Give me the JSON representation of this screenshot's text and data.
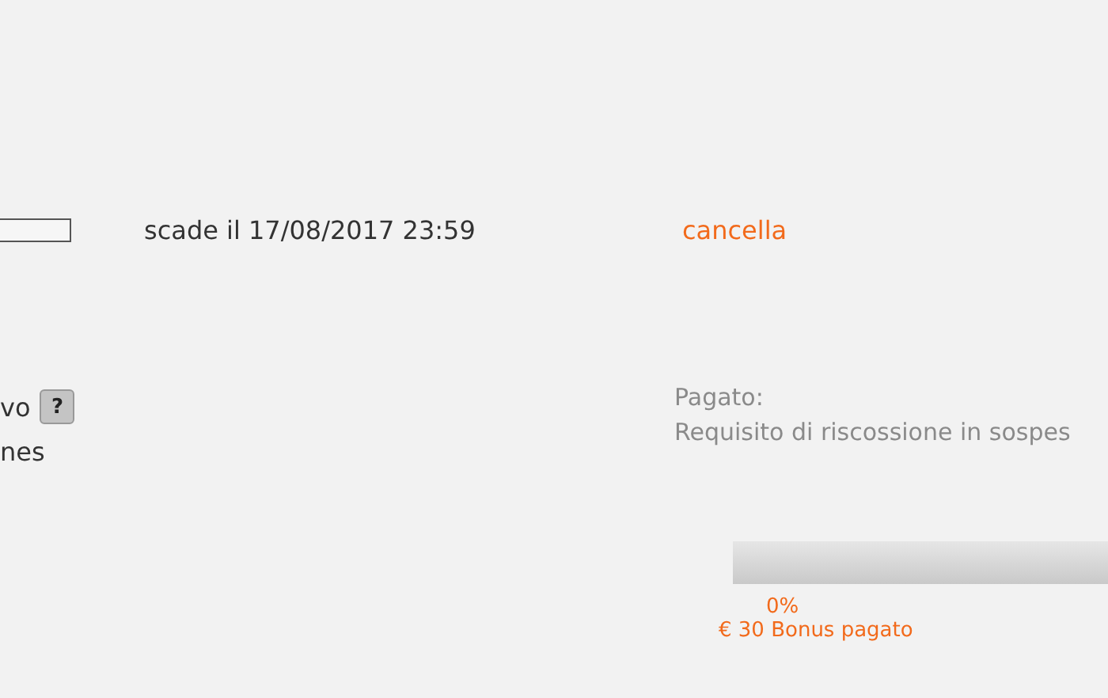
{
  "expiry": {
    "text": "scade il 17/08/2017 23:59",
    "cancel_link": "cancella"
  },
  "left_labels": [
    {
      "text": "vo",
      "help": "?"
    },
    {
      "text": "nes"
    }
  ],
  "payment": {
    "label": "Pagato:",
    "status": "Requisito di riscossione in sospes"
  },
  "progress": {
    "level": 0,
    "percent": "0%",
    "caption": "€ 30 Bonus pagato"
  }
}
